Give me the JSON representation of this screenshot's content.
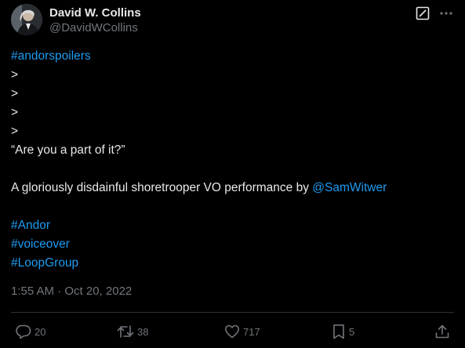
{
  "author": {
    "display_name": "David W. Collins",
    "handle": "@DavidWCollins"
  },
  "header_icons": [
    "grok-icon",
    "more-icon"
  ],
  "tweet": {
    "lines": [
      {
        "type": "link",
        "text": "#andorspoilers"
      },
      {
        "type": "text",
        "text": ">"
      },
      {
        "type": "text",
        "text": ">"
      },
      {
        "type": "text",
        "text": ">"
      },
      {
        "type": "text",
        "text": ">"
      },
      {
        "type": "text",
        "text": "“Are you a part of it?”"
      },
      {
        "type": "blank",
        "text": ""
      },
      {
        "type": "mixed",
        "text": "A gloriously disdainful shoretrooper VO performance by ",
        "mention": "@SamWitwer"
      },
      {
        "type": "blank",
        "text": ""
      },
      {
        "type": "link",
        "text": "#Andor"
      },
      {
        "type": "link",
        "text": "#voiceover"
      },
      {
        "type": "link",
        "text": "#LoopGroup"
      }
    ],
    "timestamp": "1:55 AM · Oct 20, 2022"
  },
  "actions": {
    "replies": "20",
    "retweets": "38",
    "likes": "717",
    "bookmarks": "5"
  },
  "colors": {
    "background": "#000000",
    "text": "#e7e9ea",
    "secondary": "#71767b",
    "link": "#1d9bf0",
    "divider": "#2f3336"
  }
}
